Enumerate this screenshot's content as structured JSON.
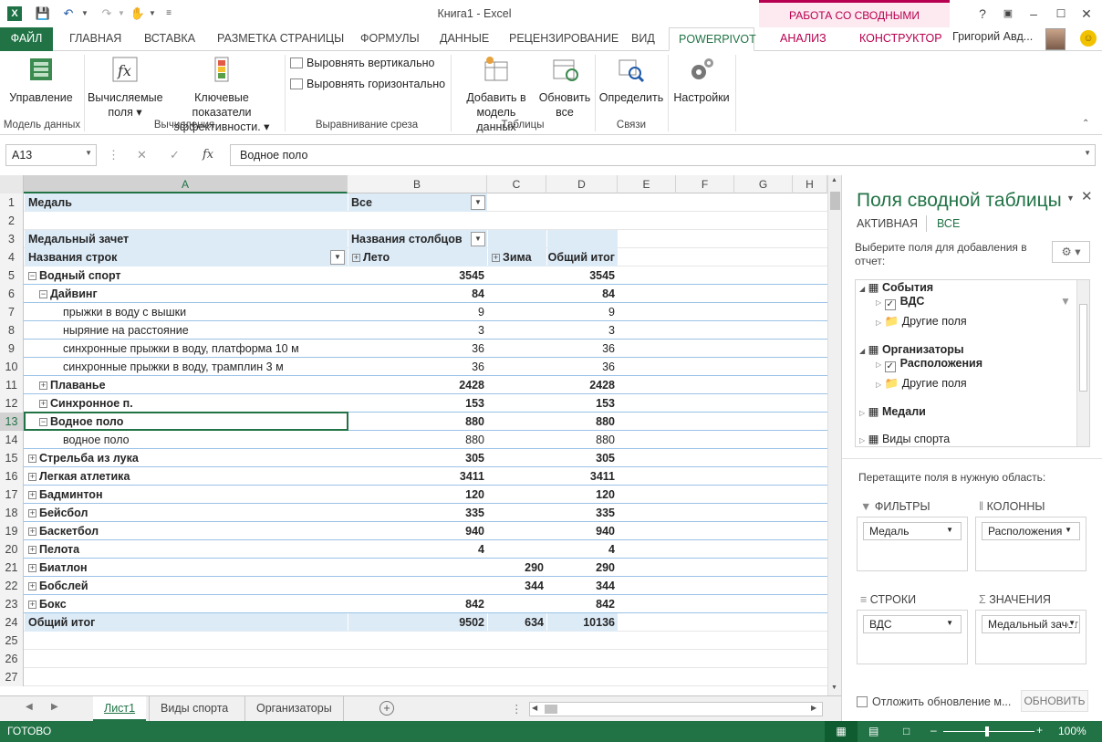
{
  "app": {
    "title": "Книга1 - Excel",
    "context_group": "РАБОТА СО СВОДНЫМИ ТАБЛИЦАМИ",
    "user": "Григорий Авд...",
    "icon_letter": "X"
  },
  "tabs": [
    "ФАЙЛ",
    "ГЛАВНАЯ",
    "ВСТАВКА",
    "РАЗМЕТКА СТРАНИЦЫ",
    "ФОРМУЛЫ",
    "ДАННЫЕ",
    "РЕЦЕНЗИРОВАНИЕ",
    "ВИД",
    "POWERPIVOT",
    "АНАЛИЗ",
    "КОНСТРУКТОР"
  ],
  "ribbon": {
    "manage": "Управление",
    "calc_fields_1": "Вычисляемые",
    "calc_fields_2": "поля",
    "kpi_1": "Ключевые показатели",
    "kpi_2": "эффективности.",
    "align_v": "Выровнять вертикально",
    "align_h": "Выровнять горизонтально",
    "add_1": "Добавить в",
    "add_2": "модель данных",
    "refresh_1": "Обновить",
    "refresh_2": "все",
    "detect": "Определить",
    "settings": "Настройки",
    "groups": {
      "model": "Модель данных",
      "calc": "Вычисления",
      "align": "Выравнивание среза",
      "tables": "Таблицы",
      "links": "Связи"
    }
  },
  "formula_bar": {
    "name_box": "A13",
    "fx": "fx",
    "value": "Водное поло"
  },
  "columns": [
    "A",
    "B",
    "C",
    "D",
    "E",
    "F",
    "G",
    "H"
  ],
  "rows": [
    {
      "n": "1",
      "a": "Медаль",
      "b": "Все",
      "c": "",
      "d": ""
    },
    {
      "n": "2",
      "a": "",
      "b": "",
      "c": "",
      "d": ""
    },
    {
      "n": "3",
      "a": "Медальный зачет",
      "b": "Названия столбцов",
      "c": "",
      "d": ""
    },
    {
      "n": "4",
      "a": "Названия строк",
      "b": "Лето",
      "c": "Зима",
      "d": "Общий итог"
    },
    {
      "n": "5",
      "a": "Водный спорт",
      "b": "3545",
      "c": "",
      "d": "3545"
    },
    {
      "n": "6",
      "a": "Дайвинг",
      "b": "84",
      "c": "",
      "d": "84"
    },
    {
      "n": "7",
      "a": "прыжки в воду с вышки",
      "b": "9",
      "c": "",
      "d": "9"
    },
    {
      "n": "8",
      "a": "ныряние на расстояние",
      "b": "3",
      "c": "",
      "d": "3"
    },
    {
      "n": "9",
      "a": "синхронные прыжки в воду, платформа 10 м",
      "b": "36",
      "c": "",
      "d": "36"
    },
    {
      "n": "10",
      "a": "синхронные прыжки в воду, трамплин 3 м",
      "b": "36",
      "c": "",
      "d": "36"
    },
    {
      "n": "11",
      "a": "Плаванье",
      "b": "2428",
      "c": "",
      "d": "2428"
    },
    {
      "n": "12",
      "a": "Синхронное п.",
      "b": "153",
      "c": "",
      "d": "153"
    },
    {
      "n": "13",
      "a": "Водное поло",
      "b": "880",
      "c": "",
      "d": "880"
    },
    {
      "n": "14",
      "a": "водное поло",
      "b": "880",
      "c": "",
      "d": "880"
    },
    {
      "n": "15",
      "a": "Стрельба из лука",
      "b": "305",
      "c": "",
      "d": "305"
    },
    {
      "n": "16",
      "a": "Легкая атлетика",
      "b": "3411",
      "c": "",
      "d": "3411"
    },
    {
      "n": "17",
      "a": "Бадминтон",
      "b": "120",
      "c": "",
      "d": "120"
    },
    {
      "n": "18",
      "a": "Бейсбол",
      "b": "335",
      "c": "",
      "d": "335"
    },
    {
      "n": "19",
      "a": "Баскетбол",
      "b": "940",
      "c": "",
      "d": "940"
    },
    {
      "n": "20",
      "a": "Пелота",
      "b": "4",
      "c": "",
      "d": "4"
    },
    {
      "n": "21",
      "a": "Биатлон",
      "b": "",
      "c": "290",
      "d": "290"
    },
    {
      "n": "22",
      "a": "Бобслей",
      "b": "",
      "c": "344",
      "d": "344"
    },
    {
      "n": "23",
      "a": "Бокс",
      "b": "842",
      "c": "",
      "d": "842"
    },
    {
      "n": "24",
      "a": "Общий итог",
      "b": "9502",
      "c": "634",
      "d": "10136"
    },
    {
      "n": "25",
      "a": "",
      "b": "",
      "c": "",
      "d": ""
    },
    {
      "n": "26",
      "a": "",
      "b": "",
      "c": "",
      "d": ""
    },
    {
      "n": "27",
      "a": "",
      "b": "",
      "c": "",
      "d": ""
    }
  ],
  "sheet_tabs": [
    "Лист1",
    "Виды спорта",
    "Организаторы"
  ],
  "status": {
    "ready": "ГОТОВО",
    "zoom": "100%"
  },
  "pane": {
    "title": "Поля сводной таблицы",
    "tab_active": "АКТИВНАЯ",
    "tab_all": "ВСЕ",
    "instruction": "Выберите поля для добавления в отчет:",
    "tree": {
      "events": "События",
      "vds": "ВДС",
      "other1": "Другие поля",
      "organizers": "Организаторы",
      "locations": "Расположения",
      "other2": "Другие поля",
      "medals": "Медали",
      "sports": "Виды спорта"
    },
    "drag_hint": "Перетащите поля в нужную область:",
    "filters": "ФИЛЬТРЫ",
    "columns": "КОЛОННЫ",
    "rows": "СТРОКИ",
    "values": "ЗНАЧЕНИЯ",
    "filters_item": "Медаль",
    "columns_item": "Расположения",
    "rows_item": "ВДС",
    "values_item": "Медальный зачет",
    "defer": "Отложить обновление м...",
    "update": "ОБНОВИТЬ"
  },
  "colors": {
    "excel_green": "#217346",
    "context": "#b7004f",
    "pivot_header": "#ddebf7"
  }
}
